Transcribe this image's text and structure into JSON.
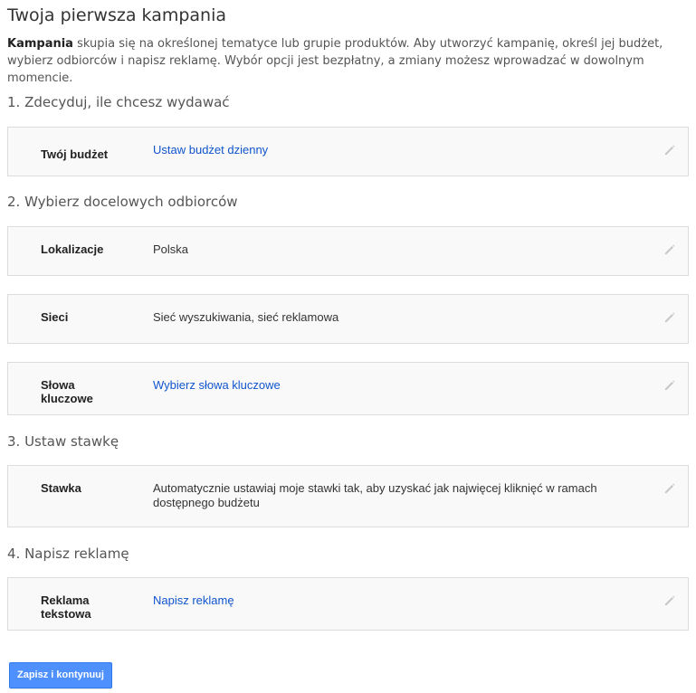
{
  "page": {
    "title": "Twoja pierwsza kampania",
    "intro_bold": "Kampania",
    "intro_rest": " skupia się na określonej tematyce lub grupie produktów. Aby utworzyć kampanię, określ jej budżet, wybierz odbiorców i napisz reklamę. Wybór opcji jest bezpłatny, a zmiany możesz wprowadzać w dowolnym momencie."
  },
  "sections": {
    "budget": {
      "heading": "1. Zdecyduj, ile chcesz wydawać",
      "label": "Twój budżet",
      "value": "Ustaw budżet dzienny"
    },
    "audience": {
      "heading": "2. Wybierz docelowych odbiorców",
      "locations_label": "Lokalizacje",
      "locations_value": "Polska",
      "networks_label": "Sieci",
      "networks_value": "Sieć wyszukiwania, sieć reklamowa",
      "keywords_label": "Słowa kluczowe",
      "keywords_value": "Wybierz słowa kluczowe"
    },
    "bid": {
      "heading": "3. Ustaw stawkę",
      "label": "Stawka",
      "value": "Automatycznie ustawiaj moje stawki tak, aby uzyskać jak najwięcej kliknięć w ramach dostępnego budżetu"
    },
    "ad": {
      "heading": "4. Napisz reklamę",
      "label": "Reklama tekstowa",
      "value": "Napisz reklamę"
    }
  },
  "actions": {
    "save_label": "Zapisz i kontynuuj"
  },
  "colors": {
    "link": "#1155cc",
    "primary_button": "#4d90fe",
    "card_background": "#f9f9f9",
    "card_border": "#dcdcdc"
  },
  "icons": {
    "edit": "pencil-icon"
  }
}
